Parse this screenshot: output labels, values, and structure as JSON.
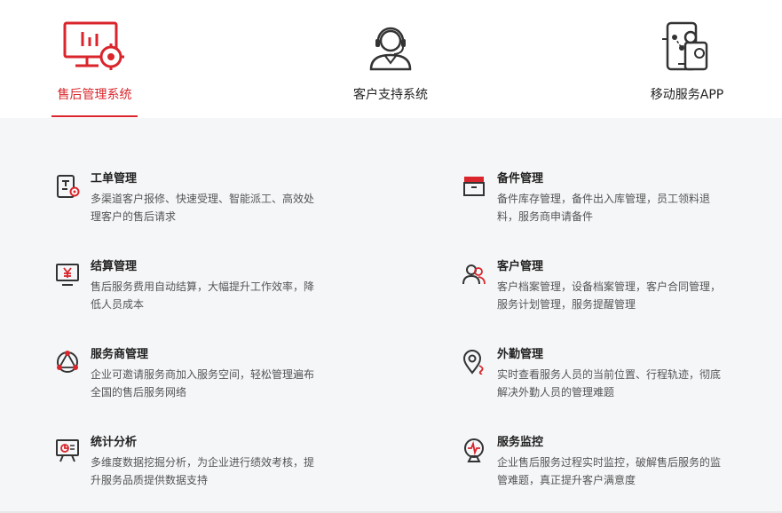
{
  "tabs": [
    {
      "label": "售后管理系统",
      "icon": "monitor-gear-icon",
      "active": true
    },
    {
      "label": "客户支持系统",
      "icon": "headset-agent-icon",
      "active": false
    },
    {
      "label": "移动服务APP",
      "icon": "mobile-app-icon",
      "active": false
    }
  ],
  "features": [
    {
      "title": "工单管理",
      "desc": "多渠道客户报修、快速受理、智能派工、高效处理客户的售后请求",
      "icon": "work-order-icon"
    },
    {
      "title": "备件管理",
      "desc": "备件库存管理，备件出入库管理，员工领料退料，服务商申请备件",
      "icon": "parts-box-icon"
    },
    {
      "title": "结算管理",
      "desc": "售后服务费用自动结算，大幅提升工作效率，降低人员成本",
      "icon": "settlement-yen-icon"
    },
    {
      "title": "客户管理",
      "desc": "客户档案管理，设备档案管理，客户合同管理，服务计划管理，服务提醒管理",
      "icon": "customers-icon"
    },
    {
      "title": "服务商管理",
      "desc": "企业可邀请服务商加入服务空间，轻松管理遍布全国的售后服务网络",
      "icon": "network-icon"
    },
    {
      "title": "外勤管理",
      "desc": "实时查看服务人员的当前位置、行程轨迹，彻底解决外勤人员的管理难题",
      "icon": "location-pin-icon"
    },
    {
      "title": "统计分析",
      "desc": "多维度数据挖掘分析，为企业进行绩效考核，提升服务品质提供数据支持",
      "icon": "statistics-board-icon"
    },
    {
      "title": "服务监控",
      "desc": "企业售后服务过程实时监控，破解售后服务的监管难题，真正提升客户满意度",
      "icon": "monitor-camera-icon"
    }
  ],
  "colors": {
    "accent": "#d9252b",
    "icon_dark": "#333333"
  }
}
